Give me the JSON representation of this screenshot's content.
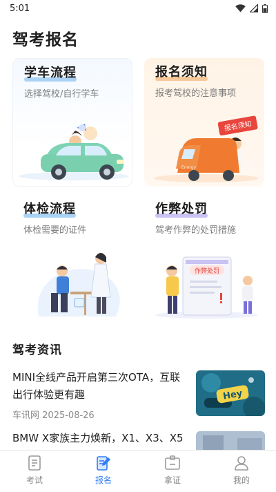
{
  "status_bar": {
    "time": "5:01"
  },
  "page_title": "驾考报名",
  "cards": [
    {
      "title": "学车流程",
      "subtitle": "选择驾校/自行学车",
      "icon": "car-with-person-illustration"
    },
    {
      "title": "报名须知",
      "subtitle": "报考驾校的注意事项",
      "icon": "truck-with-sign-illustration",
      "sign_text": "报名须知"
    },
    {
      "title": "体检流程",
      "subtitle": "体检需要的证件",
      "icon": "doctor-exam-illustration"
    },
    {
      "title": "作弊处罚",
      "subtitle": "驾考作弊的处罚措施",
      "icon": "penalty-board-illustration",
      "board_text": "作弊处罚"
    }
  ],
  "news_section_title": "驾考资讯",
  "news": [
    {
      "title": "MINI全线产品开启第三次OTA，互联出行体验更有趣",
      "source": "车讯网",
      "date": "2025-08-26",
      "thumb_text": "Hey"
    },
    {
      "title": "BMW X家族主力焕新，X1、X3、X5"
    }
  ],
  "tabs": [
    {
      "label": "考试",
      "icon": "exam-paper-icon",
      "active": false
    },
    {
      "label": "报名",
      "icon": "signup-edit-icon",
      "active": true
    },
    {
      "label": "拿证",
      "icon": "license-id-icon",
      "active": false
    },
    {
      "label": "我的",
      "icon": "user-profile-icon",
      "active": false
    }
  ],
  "colors": {
    "accent": "#2f7df6",
    "highlight_blue": "#a9d2f5",
    "highlight_purple": "#c9c2f2"
  }
}
